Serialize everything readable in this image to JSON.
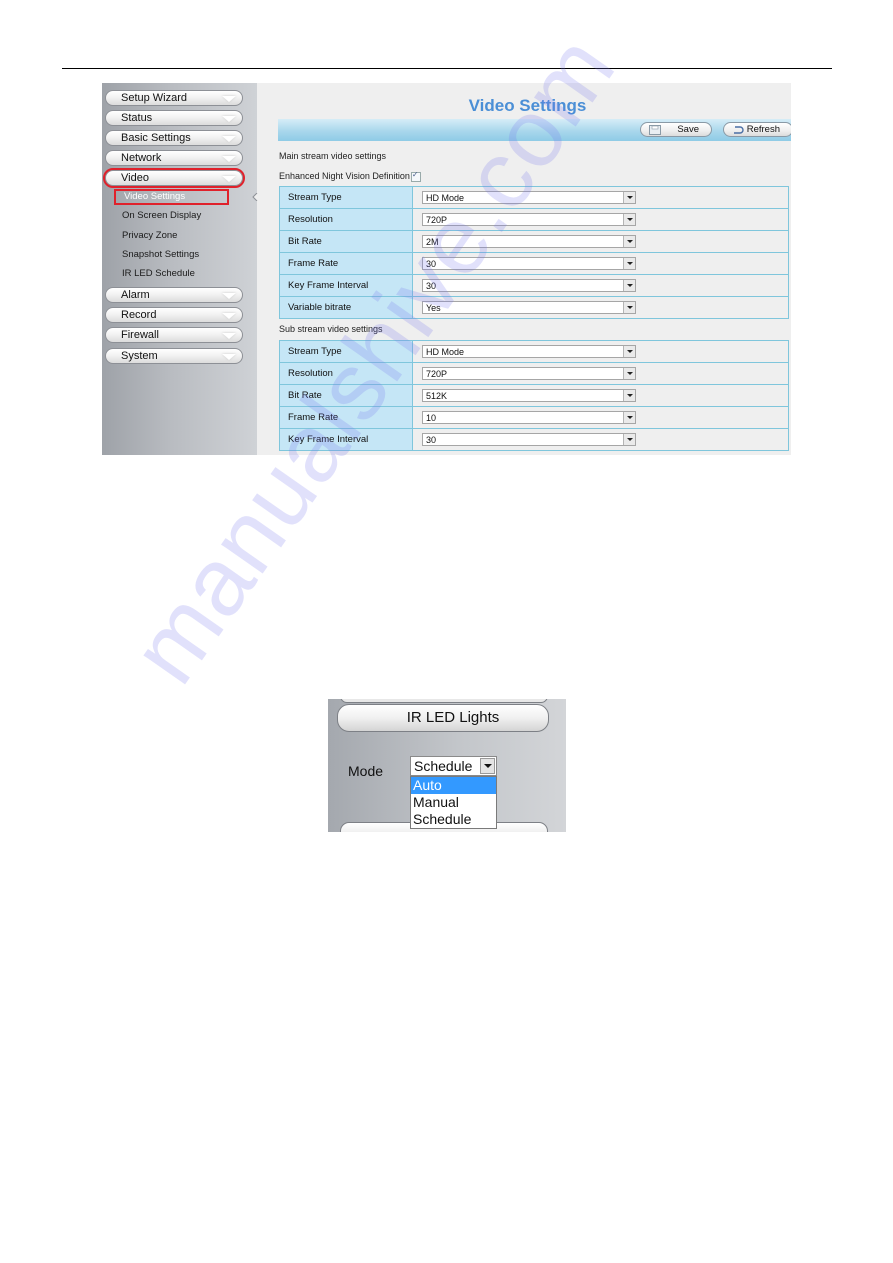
{
  "document": {
    "watermark": "manualshive.com"
  },
  "figure1": {
    "sidebar": {
      "menu": [
        {
          "label": "Setup Wizard"
        },
        {
          "label": "Status"
        },
        {
          "label": "Basic Settings"
        },
        {
          "label": "Network"
        },
        {
          "label": "Video",
          "active": true
        },
        {
          "label": "Alarm"
        },
        {
          "label": "Record"
        },
        {
          "label": "Firewall"
        },
        {
          "label": "System"
        }
      ],
      "video_submenu": [
        {
          "label": "Video Settings",
          "active": true
        },
        {
          "label": "On Screen Display"
        },
        {
          "label": "Privacy Zone"
        },
        {
          "label": "Snapshot Settings"
        },
        {
          "label": "IR LED Schedule"
        }
      ]
    },
    "page_title": "Video Settings",
    "toolbar": {
      "save_label": "Save",
      "refresh_label": "Refresh"
    },
    "main_stream": {
      "heading": "Main stream video settings",
      "night_vision_label": "Enhanced Night Vision Definition",
      "night_vision_checked": true,
      "rows": [
        {
          "label": "Stream Type",
          "value": "HD Mode"
        },
        {
          "label": "Resolution",
          "value": "720P"
        },
        {
          "label": "Bit Rate",
          "value": "2M"
        },
        {
          "label": "Frame Rate",
          "value": "30"
        },
        {
          "label": "Key Frame Interval",
          "value": "30"
        },
        {
          "label": "Variable bitrate",
          "value": "Yes"
        }
      ]
    },
    "sub_stream": {
      "heading": "Sub stream video settings",
      "rows": [
        {
          "label": "Stream Type",
          "value": "HD Mode"
        },
        {
          "label": "Resolution",
          "value": "720P"
        },
        {
          "label": "Bit Rate",
          "value": "512K"
        },
        {
          "label": "Frame Rate",
          "value": "10"
        },
        {
          "label": "Key Frame Interval",
          "value": "30"
        }
      ]
    },
    "colors": {
      "title": "#4b8fd6",
      "highlight_border": "#e0212b",
      "table_label_bg": "#c5e6f6",
      "table_border": "#7fc6dc"
    }
  },
  "figure2": {
    "panel_button": "IR LED Lights",
    "mode_label": "Mode",
    "mode_selected": "Schedule",
    "mode_options": [
      "Auto",
      "Manual",
      "Schedule"
    ],
    "highlighted_option": "Auto",
    "colors": {
      "option_highlight": "#3399ff"
    }
  }
}
